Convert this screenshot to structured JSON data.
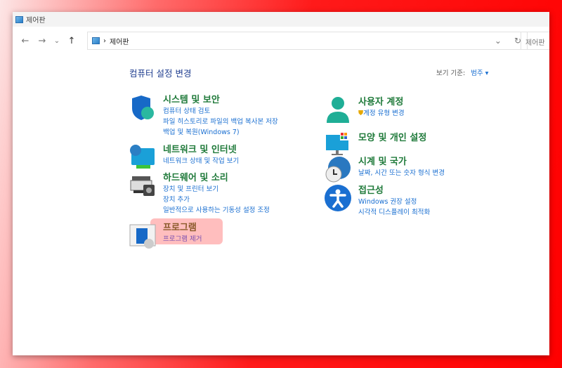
{
  "window": {
    "title": "제어판"
  },
  "nav": {
    "back": "←",
    "forward": "→",
    "recent": "⌄",
    "up": "↑"
  },
  "address": {
    "path": "제어판",
    "separator": "›",
    "dropdown": "⌄",
    "refresh": "↻"
  },
  "search": {
    "placeholder": "제어판"
  },
  "main": {
    "heading": "컴퓨터 설정 변경",
    "view_by_label": "보기 기준:",
    "view_by_value": "범주 ▾"
  },
  "categories": [
    {
      "title": "시스템 및 보안",
      "links": [
        "컴퓨터 상태 검토",
        "파일 히스토리로 파일의 백업 복사본 저장",
        "백업 및 복원(Windows 7)"
      ]
    },
    {
      "title": "네트워크 및 인터넷",
      "links": [
        "네트워크 상태 및 작업 보기"
      ]
    },
    {
      "title": "하드웨어 및 소리",
      "links": [
        "장치 및 프린터 보기",
        "장치 추가",
        "일반적으로 사용하는 기동성 설정 조정"
      ]
    },
    {
      "title": "프로그램",
      "links": [
        "프로그램 제거"
      ]
    },
    {
      "title": "사용자 계정",
      "links": [
        "계정 유형 변경"
      ]
    },
    {
      "title": "모양 및 개인 설정",
      "links": []
    },
    {
      "title": "시계 및 국가",
      "links": [
        "날짜, 시간 또는 숫자 형식 변경"
      ]
    },
    {
      "title": "접근성",
      "links": [
        "Windows 권장 설정",
        "시각적 디스플레이 최적화"
      ]
    }
  ]
}
